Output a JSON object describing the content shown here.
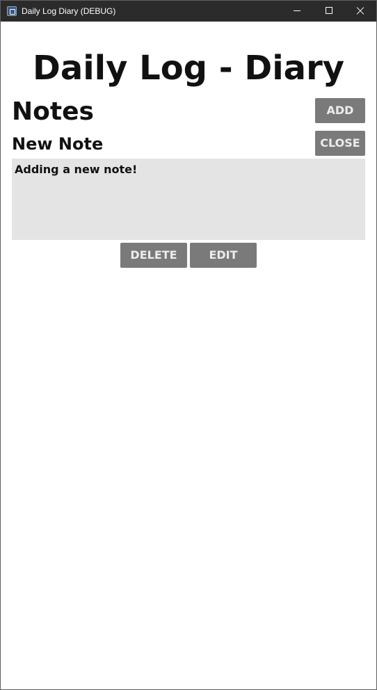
{
  "window": {
    "title": "Daily Log Diary (DEBUG)",
    "icon": "app-icon",
    "controls": [
      "minimize-icon",
      "maximize-icon",
      "close-icon"
    ]
  },
  "main": {
    "page_title": "Daily Log - Diary",
    "section_title": "Notes",
    "add_label": "ADD",
    "new_note_title": "New Note",
    "close_label": "CLOSE",
    "note_text": "Adding a new note!",
    "delete_label": "DELETE",
    "edit_label": "EDIT"
  },
  "colors": {
    "titlebar": "#2b2b2b",
    "button": "#7a7a7a",
    "button_text": "#ececec",
    "note_background": "#e4e4e4"
  }
}
